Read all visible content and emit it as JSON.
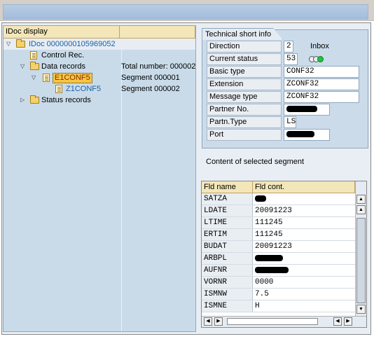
{
  "tree": {
    "header": {
      "col1": "IDoc display",
      "col2": ""
    },
    "idoc_label": "IDoc 0000000105969052",
    "control_rec": "Control Rec.",
    "data_records": "Data records",
    "data_records_total": "Total number: 000002",
    "segment1_name": "E1CONF5",
    "segment1_num": "Segment 000001",
    "segment2_name": "Z1CONF5",
    "segment2_num": "Segment 000002",
    "status_records": "Status records"
  },
  "tech_info": {
    "title": "Technical short info",
    "direction_label": "Direction",
    "direction_value": "2",
    "direction_text": "Inbox",
    "status_label": "Current status",
    "status_value": "53",
    "basic_type_label": "Basic type",
    "basic_type_value": "CONF32",
    "extension_label": "Extension",
    "extension_value": "ZCONF32",
    "message_type_label": "Message type",
    "message_type_value": "ZCONF32",
    "partner_no_label": "Partner No.",
    "partn_type_label": "Partn.Type",
    "partn_type_value": "LS",
    "port_label": "Port"
  },
  "segment_content": {
    "title": "Content of selected segment",
    "col_field": "Fld name",
    "col_content": "Fld cont.",
    "rows": [
      {
        "name": "SATZA",
        "value": ""
      },
      {
        "name": "LDATE",
        "value": "20091223"
      },
      {
        "name": "LTIME",
        "value": "111245"
      },
      {
        "name": "ERTIM",
        "value": "111245"
      },
      {
        "name": "BUDAT",
        "value": "20091223"
      },
      {
        "name": "ARBPL",
        "value": ""
      },
      {
        "name": "AUFNR",
        "value": ""
      },
      {
        "name": "VORNR",
        "value": "0000"
      },
      {
        "name": "ISMNW",
        "value": "7.5"
      },
      {
        "name": "ISMNE",
        "value": "H"
      }
    ]
  },
  "colors": {
    "tree_bg": "#c9dbe9",
    "header_bg": "#f3e6b9",
    "selected_segment": "#f7c542",
    "status_green": "#22c33b"
  }
}
